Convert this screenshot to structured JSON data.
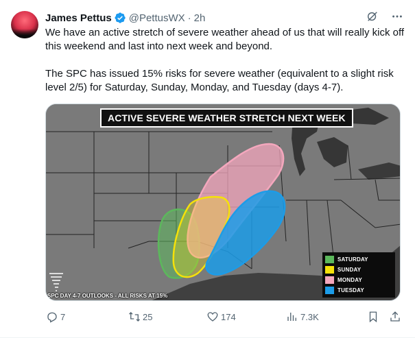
{
  "author": {
    "name": "James Pettus",
    "handle": "@PettusWX",
    "separator": "·",
    "time": "2h"
  },
  "tweet": {
    "paragraph1": "We have an active stretch of severe weather ahead of us that will really kick off this weekend and last into next week and beyond.",
    "paragraph2": "The SPC has issued 15% risks for severe weather (equivalent to a slight risk level 2/5) for Saturday, Sunday, Monday, and Tuesday (days 4-7)."
  },
  "media": {
    "banner": "ACTIVE SEVERE WEATHER STRETCH NEXT WEEK",
    "footer": "SPC DAY 4-7 OUTLOOKS - ALL RISKS AT 15%",
    "legend": [
      {
        "label": "SATURDAY",
        "color": "#5cb85c"
      },
      {
        "label": "SUNDAY",
        "color": "#f5e10a"
      },
      {
        "label": "MONDAY",
        "color": "#f4a7bd"
      },
      {
        "label": "TUESDAY",
        "color": "#1c9ce8"
      }
    ]
  },
  "actions": {
    "replies": "7",
    "reposts": "25",
    "likes": "174",
    "views": "7.3K"
  },
  "icons": {
    "verified": "verified-badge-icon",
    "grok": "grok-icon",
    "more": "more-icon",
    "reply": "reply-icon",
    "repost": "repost-icon",
    "like": "like-icon",
    "views": "views-icon",
    "bookmark": "bookmark-icon",
    "share": "share-icon"
  },
  "colors": {
    "accent": "#1d9bf0",
    "muted": "#536471",
    "text": "#0f1419"
  }
}
